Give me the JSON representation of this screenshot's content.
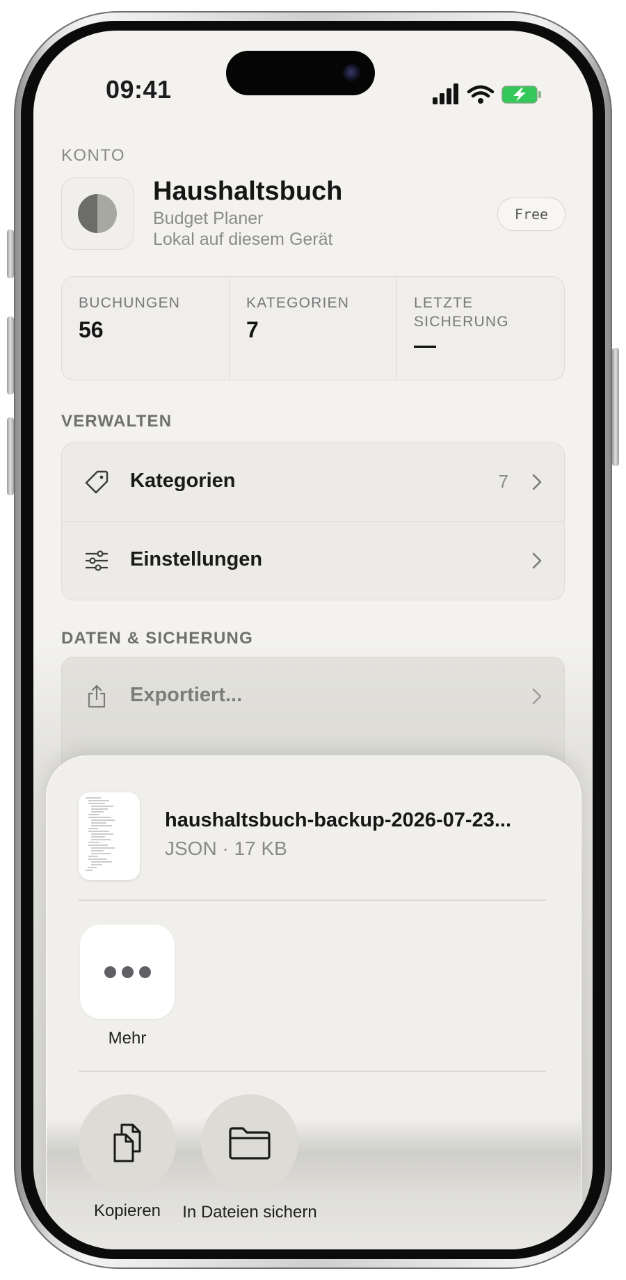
{
  "status_bar": {
    "time": "09:41"
  },
  "account": {
    "section_label": "KONTO",
    "app_name": "Haushaltsbuch",
    "subtitle": "Budget Planer",
    "storage": "Lokal auf diesem Gerät",
    "plan_badge": "Free"
  },
  "stats": [
    {
      "label": "BUCHUNGEN",
      "value": "56"
    },
    {
      "label": "KATEGORIEN",
      "value": "7"
    },
    {
      "label": "LETZTE SICHERUNG",
      "value": "—"
    }
  ],
  "manage": {
    "section_label": "VERWALTEN",
    "items": [
      {
        "label": "Kategorien",
        "count": "7",
        "icon": "tag-icon"
      },
      {
        "label": "Einstellungen",
        "icon": "sliders-icon"
      }
    ]
  },
  "data_backup": {
    "section_label": "DATEN & SICHERUNG",
    "export_label": "Exportiert..."
  },
  "share_sheet": {
    "file_name": "haushaltsbuch-backup-2026-07-23...",
    "file_meta": "JSON · 17 KB",
    "apps": [
      {
        "label": "Mehr",
        "icon": "more-icon"
      }
    ],
    "actions": [
      {
        "label": "Kopieren",
        "icon": "copy-icon"
      },
      {
        "label": "In Dateien sichern",
        "icon": "folder-icon"
      }
    ]
  },
  "colors": {
    "background": "#f3f2ee",
    "battery_green": "#34c759",
    "text_primary": "#151515",
    "text_secondary": "#8b8b87"
  }
}
